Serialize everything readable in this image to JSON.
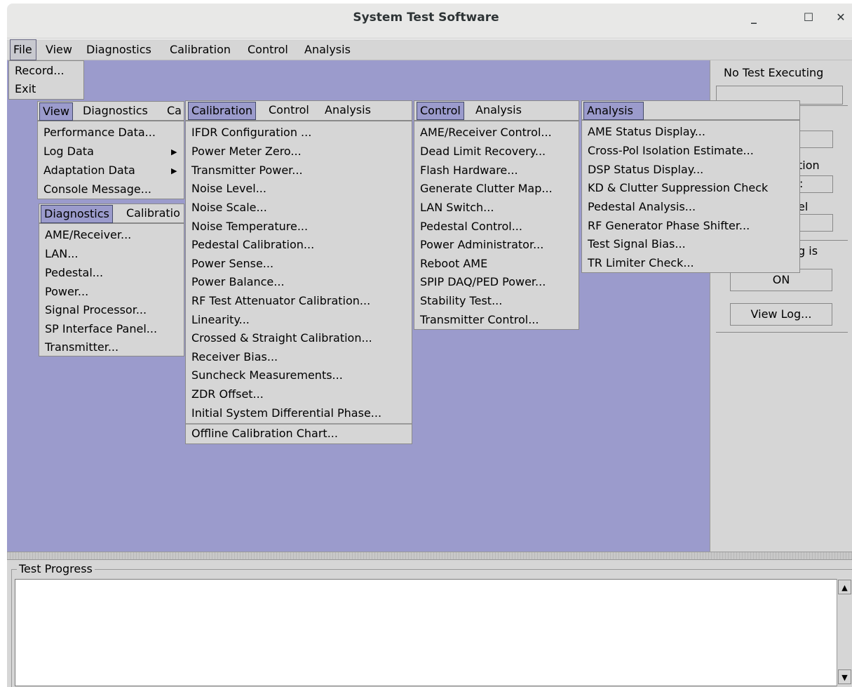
{
  "window": {
    "title": "System Test Software",
    "minimize": "_",
    "maximize": "☐",
    "close": "✕"
  },
  "menubar": {
    "items": [
      "File",
      "View",
      "Diagnostics",
      "Calibration",
      "Control",
      "Analysis"
    ]
  },
  "file_menu": {
    "items": [
      "Record...",
      "Exit"
    ]
  },
  "view_menu": {
    "header": [
      "View",
      "Diagnostics",
      "Ca"
    ],
    "items": [
      "Performance Data...",
      "Log Data",
      "Adaptation Data",
      "Console Message..."
    ]
  },
  "diag_menu": {
    "header": [
      "Diagnostics",
      "Calibratio"
    ],
    "items": [
      "AME/Receiver...",
      "LAN...",
      "Pedestal...",
      "Power...",
      "Signal Processor...",
      "SP Interface Panel...",
      "Transmitter..."
    ]
  },
  "cal_menu": {
    "header": [
      "Calibration",
      "Control",
      "Analysis"
    ],
    "items": [
      "IFDR Configuration ...",
      "Power Meter Zero...",
      "Transmitter Power...",
      "Noise Level...",
      "Noise Scale...",
      "Noise Temperature...",
      "Pedestal Calibration...",
      "Power Sense...",
      "Power Balance...",
      "RF Test Attenuator Calibration...",
      "Linearity...",
      "Crossed & Straight Calibration...",
      "Receiver Bias...",
      "Suncheck Measurements...",
      "ZDR Offset...",
      "Initial System Differential Phase...",
      "Offline Calibration Chart..."
    ]
  },
  "control_menu": {
    "header": [
      "Control",
      "Analysis"
    ],
    "items": [
      "AME/Receiver Control...",
      "Dead Limit Recovery...",
      "Flash Hardware...",
      "Generate Clutter Map...",
      "LAN Switch...",
      "Pedestal Control...",
      "Power Administrator...",
      "Reboot AME",
      "SPIP DAQ/PED Power...",
      "Stability Test...",
      "Transmitter Control..."
    ]
  },
  "analysis_menu": {
    "header": [
      "Analysis"
    ],
    "items": [
      "AME Status Display...",
      "Cross-Pol Isolation Estimate...",
      "DSP Status Display...",
      "KD & Clutter Suppression Check",
      "Pedestal Analysis...",
      "RF Generator Phase Shifter...",
      "Test Signal Bias...",
      "TR Limiter Check..."
    ]
  },
  "right_panel": {
    "status": "No Test Executing",
    "partial_1": "tion",
    "partial_2": "el",
    "partial_3": "g is",
    "partial_4": ":",
    "on_button": "ON",
    "view_log_button": "View Log..."
  },
  "bottom": {
    "group_label": "Test Progress"
  }
}
